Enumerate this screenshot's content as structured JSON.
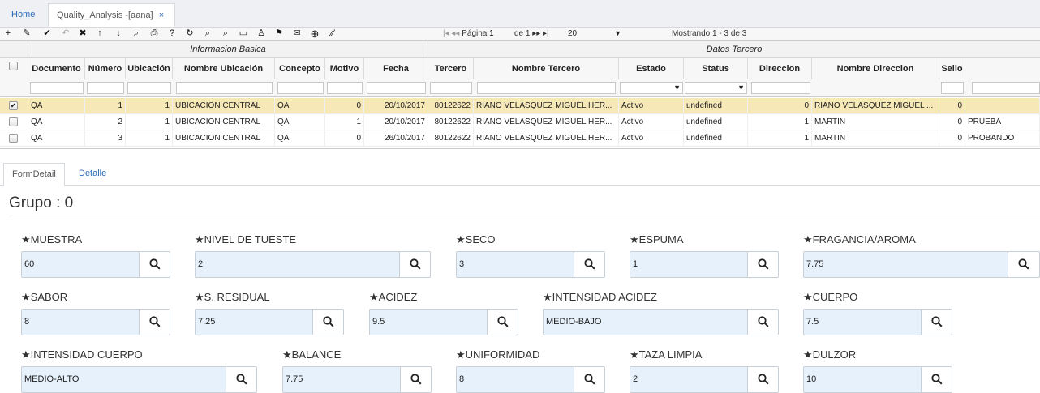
{
  "tabs": {
    "home": "Home",
    "active": "Quality_Analysis -[aana]",
    "close": "×"
  },
  "toolbar": {
    "pager_label": "Página",
    "page_value": "1",
    "of_label": "de 1",
    "rows_per_page": "20",
    "showing": "Mostrando 1 - 3 de 3"
  },
  "grid": {
    "groups": {
      "basic": "Informacion Basica",
      "third": "Datos Tercero"
    },
    "headers": [
      "Documento",
      "Número",
      "Ubicación",
      "Nombre Ubicación",
      "Concepto",
      "Motivo",
      "Fecha",
      "Tercero",
      "Nombre Tercero",
      "Estado",
      "Status",
      "Direccion",
      "Nombre Direccion",
      "Sello"
    ],
    "rows": [
      {
        "documento": "QA",
        "numero": "1",
        "ubicacion": "1",
        "nombre_ubicacion": "UBICACION CENTRAL",
        "concepto": "QA",
        "motivo": "0",
        "fecha": "20/10/2017",
        "tercero": "80122622",
        "nombre_tercero": "RIANO VELASQUEZ MIGUEL HER...",
        "estado": "Activo",
        "status": "undefined",
        "direccion": "0",
        "nombre_direccion": "RIANO VELASQUEZ MIGUEL ...",
        "sello": "0",
        "extra": ""
      },
      {
        "documento": "QA",
        "numero": "2",
        "ubicacion": "1",
        "nombre_ubicacion": "UBICACION CENTRAL",
        "concepto": "QA",
        "motivo": "1",
        "fecha": "20/10/2017",
        "tercero": "80122622",
        "nombre_tercero": "RIANO VELASQUEZ MIGUEL HER...",
        "estado": "Activo",
        "status": "undefined",
        "direccion": "1",
        "nombre_direccion": "MARTIN",
        "sello": "0",
        "extra": "PRUEBA"
      },
      {
        "documento": "QA",
        "numero": "3",
        "ubicacion": "1",
        "nombre_ubicacion": "UBICACION CENTRAL",
        "concepto": "QA",
        "motivo": "0",
        "fecha": "26/10/2017",
        "tercero": "80122622",
        "nombre_tercero": "RIANO VELASQUEZ MIGUEL HER...",
        "estado": "Activo",
        "status": "undefined",
        "direccion": "1",
        "nombre_direccion": "MARTIN",
        "sello": "0",
        "extra": "PROBANDO"
      }
    ]
  },
  "detail_tabs": {
    "form": "FormDetail",
    "detail": "Detalle"
  },
  "form": {
    "group_title": "Grupo : 0",
    "fields": {
      "muestra": {
        "label": "★MUESTRA",
        "value": "60"
      },
      "nivel_tueste": {
        "label": "★NIVEL DE TUESTE",
        "value": "2"
      },
      "seco": {
        "label": "★SECO",
        "value": "3"
      },
      "espuma": {
        "label": "★ESPUMA",
        "value": "1"
      },
      "fragancia": {
        "label": "★FRAGANCIA/AROMA",
        "value": "7.75"
      },
      "sabor": {
        "label": "★SABOR",
        "value": "8"
      },
      "s_residual": {
        "label": "★S. RESIDUAL",
        "value": "7.25"
      },
      "acidez": {
        "label": "★ACIDEZ",
        "value": "9.5"
      },
      "intensidad_acidez": {
        "label": "★INTENSIDAD ACIDEZ",
        "value": "MEDIO-BAJO"
      },
      "cuerpo": {
        "label": "★CUERPO",
        "value": "7.5"
      },
      "intensidad_cuerpo": {
        "label": "★INTENSIDAD CUERPO",
        "value": "MEDIO-ALTO"
      },
      "balance": {
        "label": "★BALANCE",
        "value": "7.75"
      },
      "uniformidad": {
        "label": "★UNIFORMIDAD",
        "value": "8"
      },
      "taza_limpia": {
        "label": "★TAZA LIMPIA",
        "value": "2"
      },
      "dulzor": {
        "label": "★DULZOR",
        "value": "10"
      }
    }
  }
}
